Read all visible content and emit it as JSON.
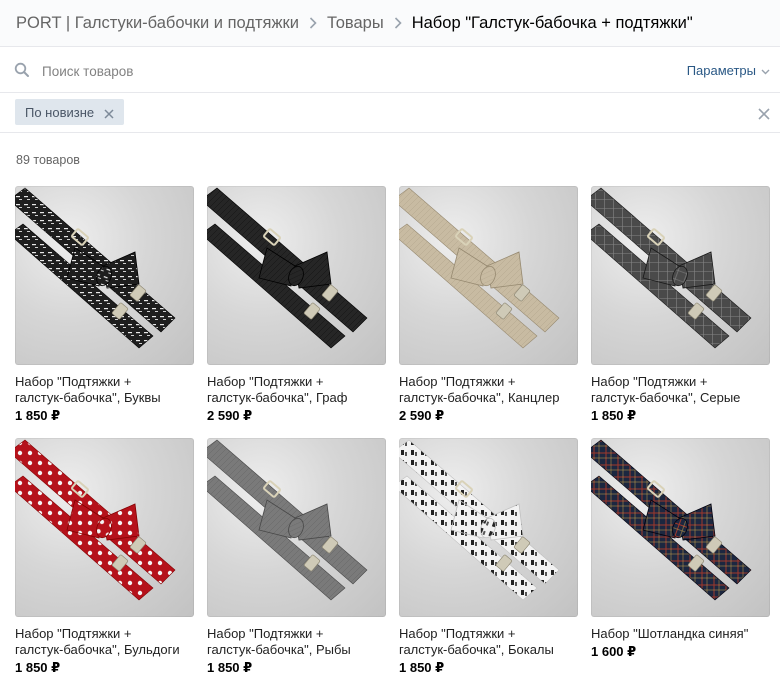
{
  "breadcrumb": {
    "items": [
      "PORT | Галстуки-бабочки и подтяжки",
      "Товары",
      "Набор \"Галстук-бабочка + подтяжки\""
    ]
  },
  "search": {
    "placeholder": "Поиск товаров",
    "params_label": "Параметры"
  },
  "filters": {
    "sort_chip": "По новизне"
  },
  "results": {
    "count_label": "89 товаров"
  },
  "colors": {
    "link": "#2a5885",
    "chip_bg": "#dfe6ed"
  },
  "products": [
    {
      "name_line1": "Набор \"Подтяжки +",
      "name_line2": "галстук-бабочка\", Буквы",
      "price": "1 850 ₽",
      "strap_color": "#1e1e1e",
      "pattern": "letters"
    },
    {
      "name_line1": "Набор \"Подтяжки +",
      "name_line2": "галстук-бабочка\", Граф",
      "price": "2 590 ₽",
      "strap_color": "#262626",
      "pattern": "plain"
    },
    {
      "name_line1": "Набор \"Подтяжки +",
      "name_line2": "галстук-бабочка\", Канцлер",
      "price": "2 590 ₽",
      "strap_color": "#c8bba2",
      "pattern": "plain"
    },
    {
      "name_line1": "Набор \"Подтяжки +",
      "name_line2": "галстук-бабочка\", Серые",
      "price": "1 850 ₽",
      "strap_color": "#4a4a4a",
      "pattern": "check"
    },
    {
      "name_line1": "Набор \"Подтяжки +",
      "name_line2": "галстук-бабочка\", Бульдоги",
      "price": "1 850 ₽",
      "strap_color": "#b5121b",
      "pattern": "dots"
    },
    {
      "name_line1": "Набор \"Подтяжки +",
      "name_line2": "галстук-бабочка\", Рыбы",
      "price": "1 850 ₽",
      "strap_color": "#7a7a7a",
      "pattern": "plain"
    },
    {
      "name_line1": "Набор \"Подтяжки +",
      "name_line2": "галстук-бабочка\", Бокалы",
      "price": "1 850 ₽",
      "strap_color": "#f2f2f2",
      "pattern": "print"
    },
    {
      "name_line1": "Набор \"Шотландка синяя\"",
      "name_line2": "",
      "price": "1 600 ₽",
      "strap_color": "#1c2740",
      "pattern": "tartan"
    }
  ]
}
